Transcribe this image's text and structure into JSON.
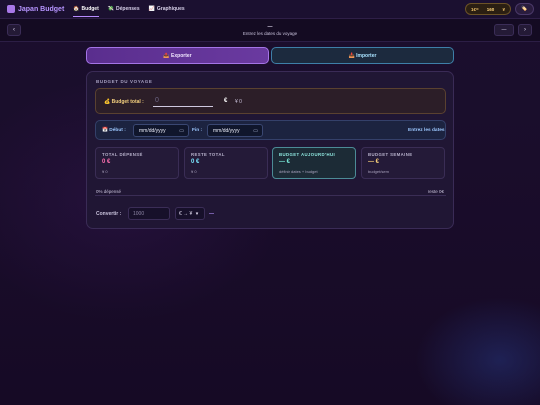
{
  "app": {
    "title": "Japan Budget"
  },
  "nav": {
    "tabs": [
      {
        "icon": "🏠",
        "label": "Budget"
      },
      {
        "icon": "💸",
        "label": "Dépenses"
      },
      {
        "icon": "📈",
        "label": "Graphiques"
      }
    ]
  },
  "rate": {
    "left": "1€=",
    "value": "160",
    "unit": "¥"
  },
  "tag_button": {
    "icon": "🏷️"
  },
  "date_nav": {
    "prev": "‹",
    "next": "›",
    "current": "—",
    "hint": "Entrez les dates du voyage",
    "mode": "—"
  },
  "actions": {
    "export": "📤 Exporter",
    "import": "📥 Importer"
  },
  "budget": {
    "section_title": "BUDGET DU VOYAGE",
    "total_label": "💰 Budget total :",
    "total_placeholder": "0",
    "currency": "€",
    "yen": "¥ 0"
  },
  "dates": {
    "start_label": "📅 Début :",
    "start_value": "mm/dd/yyyy",
    "end_label": "Fin :",
    "end_value": "mm/dd/yyyy",
    "hint": "Entrez les dates"
  },
  "stats": [
    {
      "label": "TOTAL DÉPENSÉ",
      "value": "0 €",
      "sub": "¥ 0",
      "color": "#ff6fb0"
    },
    {
      "label": "RESTE TOTAL",
      "value": "0 €",
      "sub": "¥ 0",
      "color": "#7be6ff"
    },
    {
      "label": "BUDGET AUJOURD'HUI",
      "value": "— €",
      "sub": "définir dates + budget",
      "color": "#7cf0de"
    },
    {
      "label": "BUDGET SEMAINE",
      "value": "— €",
      "sub": "budget/sem",
      "color": "#ffd57a"
    }
  ],
  "progress": {
    "spent_label": "0% dépensé",
    "remaining_label": "reste 0€",
    "fraction": 0
  },
  "converter": {
    "label": "Convertir :",
    "placeholder": "1000",
    "direction": "€ → ¥",
    "result": "—"
  }
}
